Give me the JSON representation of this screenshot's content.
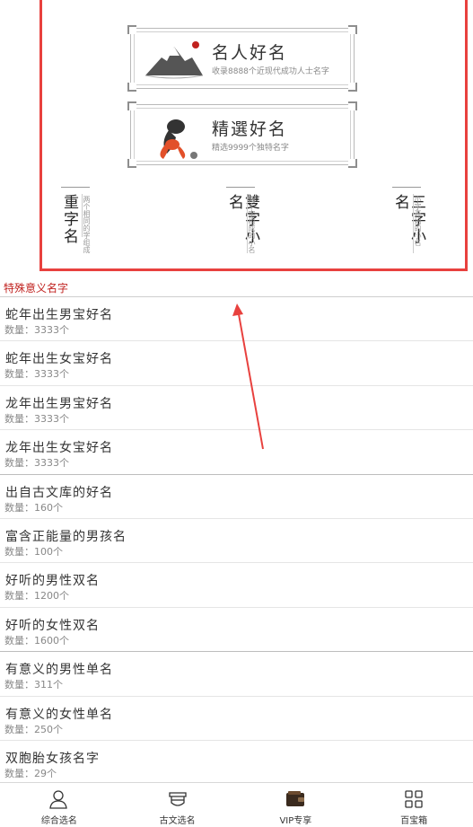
{
  "banners": [
    {
      "title": "名人好名",
      "subtitle": "收录8888个近现代成功人士名字",
      "art": "mountain-seal-icon"
    },
    {
      "title": "精選好名",
      "subtitle": "精选9999个独特名字",
      "art": "goldfish-icon"
    }
  ],
  "cards": [
    {
      "title": "重字名",
      "note": "两个相同的字组成"
    },
    {
      "title": "雙字小名",
      "note": "两个字组成的小名"
    },
    {
      "title": "三字小名",
      "note": "小字开始的小名"
    }
  ],
  "section": {
    "title": "特殊意义名字"
  },
  "items": [
    {
      "title": "蛇年出生男宝好名",
      "count": "数量：3333个"
    },
    {
      "title": "蛇年出生女宝好名",
      "count": "数量：3333个"
    },
    {
      "title": "龙年出生男宝好名",
      "count": "数量：3333个"
    },
    {
      "title": "龙年出生女宝好名",
      "count": "数量：3333个"
    },
    {
      "title": "出自古文库的好名",
      "count": "数量：160个"
    },
    {
      "title": "富含正能量的男孩名",
      "count": "数量：100个"
    },
    {
      "title": "好听的男性双名",
      "count": "数量：1200个"
    },
    {
      "title": "好听的女性双名",
      "count": "数量：1600个"
    },
    {
      "title": "有意义的男性单名",
      "count": "数量：311个"
    },
    {
      "title": "有意义的女性单名",
      "count": "数量：250个"
    },
    {
      "title": "双胞胎女孩名字",
      "count": "数量：29个"
    }
  ],
  "tabs": [
    {
      "label": "综合选名",
      "icon": "person-icon"
    },
    {
      "label": "古文选名",
      "icon": "book-icon"
    },
    {
      "label": "VIP专享",
      "icon": "wallet-icon",
      "active": true
    },
    {
      "label": "百宝箱",
      "icon": "grid-icon"
    }
  ],
  "colors": {
    "accent_red": "#c0221f",
    "frame_red": "#e8413e"
  }
}
